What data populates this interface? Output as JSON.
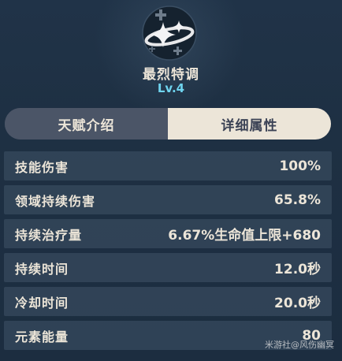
{
  "talent": {
    "name": "最烈特调",
    "level": "Lv.4",
    "emblem_icon": "talent-sparkle-icon"
  },
  "tabs": [
    {
      "label": "天赋介绍",
      "active": false
    },
    {
      "label": "详细属性",
      "active": true
    }
  ],
  "stats": [
    {
      "label": "技能伤害",
      "value": "100%"
    },
    {
      "label": "领域持续伤害",
      "value": "65.8%"
    },
    {
      "label": "持续治疗量",
      "value": "6.67%生命值上限+680"
    },
    {
      "label": "持续时间",
      "value": "12.0秒"
    },
    {
      "label": "冷却时间",
      "value": "20.0秒"
    },
    {
      "label": "元素能量",
      "value": "80"
    }
  ],
  "watermark": "米游社@风伤幽冥",
  "colors": {
    "background": "#1f3246",
    "text": "#ece5d8",
    "level": "#6fd4ef",
    "tab_active_bg": "#ece5d8",
    "tab_inactive_bg": "#4b5567"
  }
}
